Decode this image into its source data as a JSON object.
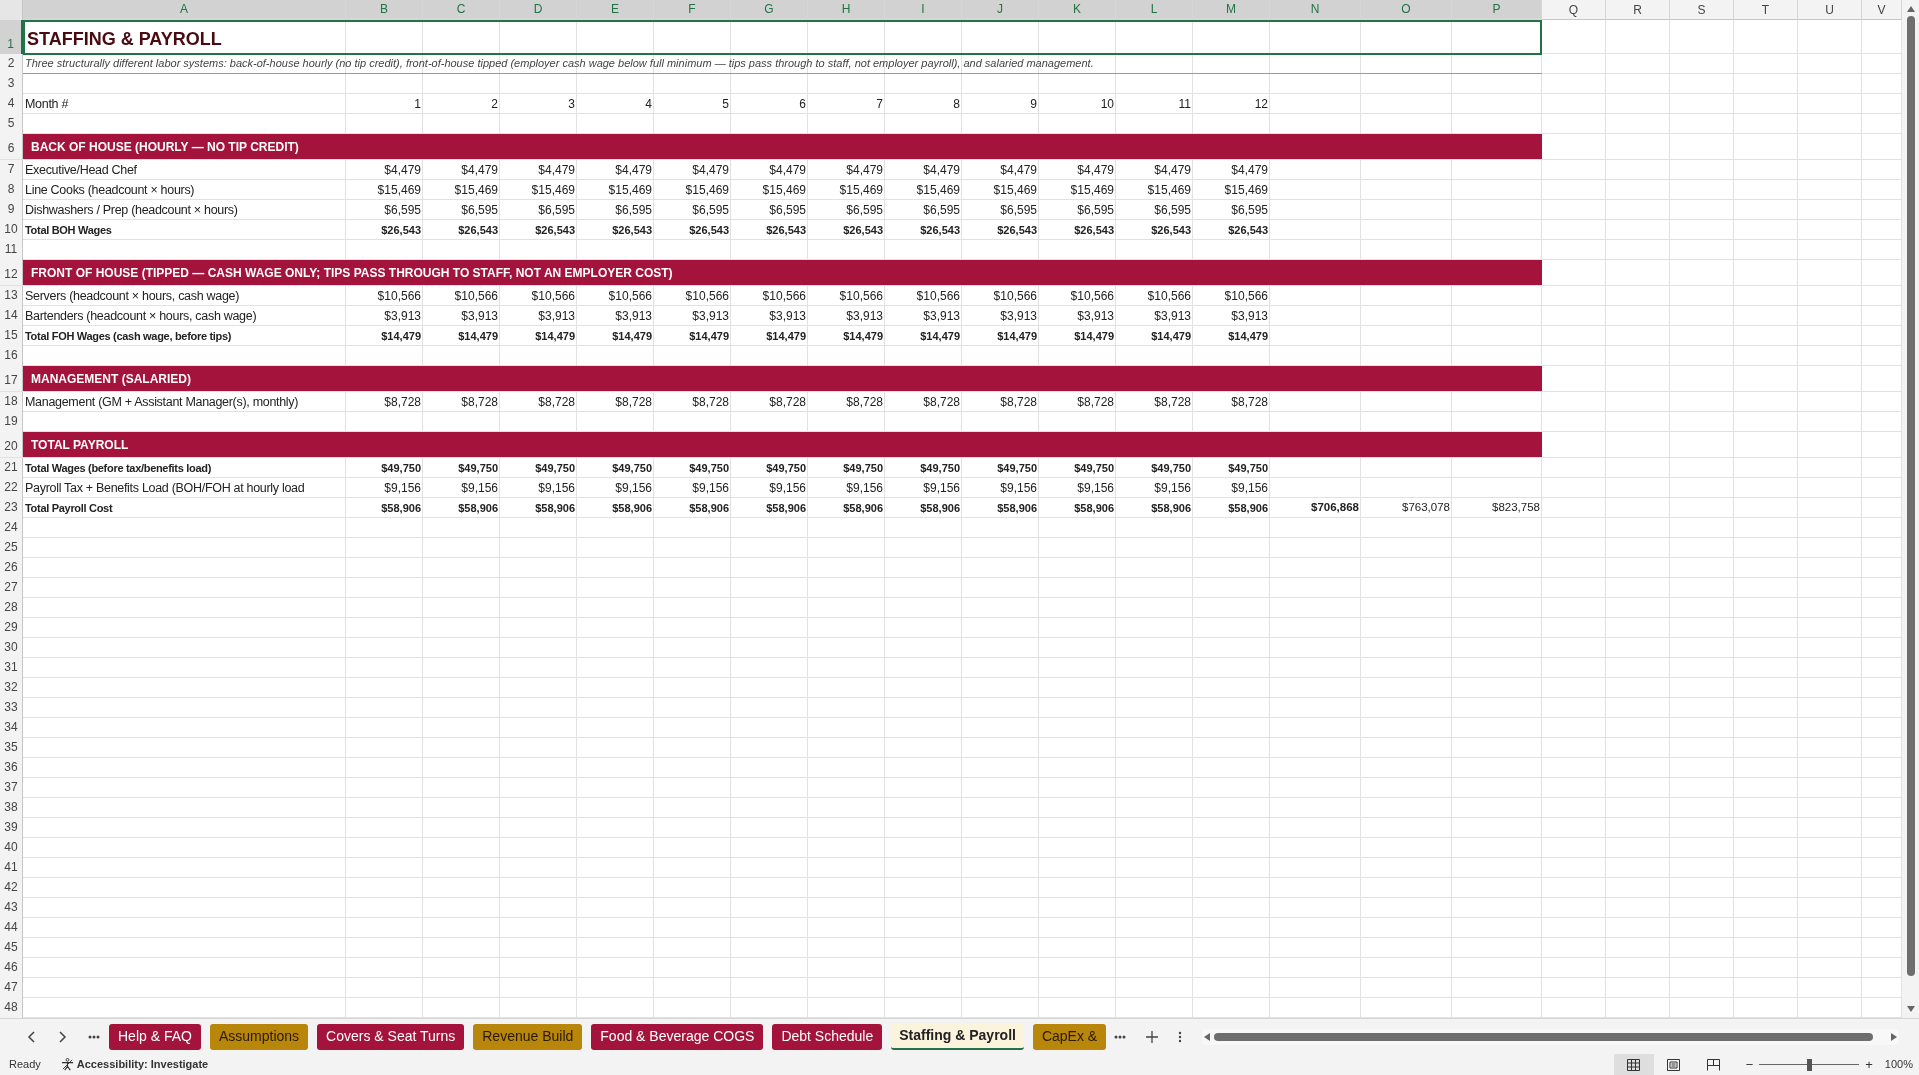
{
  "columns": [
    {
      "label": "A",
      "selected": true
    },
    {
      "label": "B",
      "selected": true
    },
    {
      "label": "C",
      "selected": true
    },
    {
      "label": "D",
      "selected": true
    },
    {
      "label": "E",
      "selected": true
    },
    {
      "label": "F",
      "selected": true
    },
    {
      "label": "G",
      "selected": true
    },
    {
      "label": "H",
      "selected": true
    },
    {
      "label": "I",
      "selected": true
    },
    {
      "label": "J",
      "selected": true
    },
    {
      "label": "K",
      "selected": true
    },
    {
      "label": "L",
      "selected": true
    },
    {
      "label": "M",
      "selected": true
    },
    {
      "label": "N",
      "selected": true
    },
    {
      "label": "O",
      "selected": true
    },
    {
      "label": "P",
      "selected": true
    },
    {
      "label": "Q",
      "selected": false
    },
    {
      "label": "R",
      "selected": false
    },
    {
      "label": "S",
      "selected": false
    },
    {
      "label": "T",
      "selected": false
    },
    {
      "label": "U",
      "selected": false
    },
    {
      "label": "V",
      "selected": false
    }
  ],
  "rows": [
    {
      "number": "1",
      "selected": true,
      "kind": "title",
      "label": "STAFFING & PAYROLL"
    },
    {
      "number": "2",
      "selected": false,
      "kind": "subtitle",
      "label": "Three structurally different labor systems: back-of-house hourly (no tip credit), front-of-house tipped (employer cash wage below full minimum — tips pass through to staff, not employer payroll), and salaried management."
    },
    {
      "number": "3",
      "selected": false,
      "kind": "blank"
    },
    {
      "number": "4",
      "selected": false,
      "kind": "item",
      "label": "Month #",
      "values": [
        "1",
        "2",
        "3",
        "4",
        "5",
        "6",
        "7",
        "8",
        "9",
        "10",
        "11",
        "12"
      ]
    },
    {
      "number": "5",
      "selected": false,
      "kind": "blank"
    },
    {
      "number": "6",
      "selected": false,
      "kind": "section",
      "label": "BACK OF HOUSE (HOURLY — NO TIP CREDIT)"
    },
    {
      "number": "7",
      "selected": false,
      "kind": "item",
      "label": "Executive/Head Chef",
      "values": [
        "$4,479",
        "$4,479",
        "$4,479",
        "$4,479",
        "$4,479",
        "$4,479",
        "$4,479",
        "$4,479",
        "$4,479",
        "$4,479",
        "$4,479",
        "$4,479"
      ]
    },
    {
      "number": "8",
      "selected": false,
      "kind": "item",
      "label": "Line Cooks (headcount × hours)",
      "values": [
        "$15,469",
        "$15,469",
        "$15,469",
        "$15,469",
        "$15,469",
        "$15,469",
        "$15,469",
        "$15,469",
        "$15,469",
        "$15,469",
        "$15,469",
        "$15,469"
      ]
    },
    {
      "number": "9",
      "selected": false,
      "kind": "item",
      "label": "Dishwashers / Prep (headcount × hours)",
      "values": [
        "$6,595",
        "$6,595",
        "$6,595",
        "$6,595",
        "$6,595",
        "$6,595",
        "$6,595",
        "$6,595",
        "$6,595",
        "$6,595",
        "$6,595",
        "$6,595"
      ]
    },
    {
      "number": "10",
      "selected": false,
      "kind": "total",
      "label": "Total BOH Wages",
      "values": [
        "$26,543",
        "$26,543",
        "$26,543",
        "$26,543",
        "$26,543",
        "$26,543",
        "$26,543",
        "$26,543",
        "$26,543",
        "$26,543",
        "$26,543",
        "$26,543"
      ]
    },
    {
      "number": "11",
      "selected": false,
      "kind": "blank"
    },
    {
      "number": "12",
      "selected": false,
      "kind": "section",
      "label": "FRONT OF HOUSE (TIPPED — CASH WAGE ONLY; TIPS PASS THROUGH TO STAFF, NOT AN EMPLOYER COST)"
    },
    {
      "number": "13",
      "selected": false,
      "kind": "item",
      "label": "Servers (headcount × hours, cash wage)",
      "values": [
        "$10,566",
        "$10,566",
        "$10,566",
        "$10,566",
        "$10,566",
        "$10,566",
        "$10,566",
        "$10,566",
        "$10,566",
        "$10,566",
        "$10,566",
        "$10,566"
      ]
    },
    {
      "number": "14",
      "selected": false,
      "kind": "item",
      "label": "Bartenders (headcount × hours, cash wage)",
      "values": [
        "$3,913",
        "$3,913",
        "$3,913",
        "$3,913",
        "$3,913",
        "$3,913",
        "$3,913",
        "$3,913",
        "$3,913",
        "$3,913",
        "$3,913",
        "$3,913"
      ]
    },
    {
      "number": "15",
      "selected": false,
      "kind": "total",
      "label": "Total FOH Wages (cash wage, before tips)",
      "values": [
        "$14,479",
        "$14,479",
        "$14,479",
        "$14,479",
        "$14,479",
        "$14,479",
        "$14,479",
        "$14,479",
        "$14,479",
        "$14,479",
        "$14,479",
        "$14,479"
      ]
    },
    {
      "number": "16",
      "selected": false,
      "kind": "blank"
    },
    {
      "number": "17",
      "selected": false,
      "kind": "section",
      "label": "MANAGEMENT (SALARIED)"
    },
    {
      "number": "18",
      "selected": false,
      "kind": "item",
      "label": "Management (GM + Assistant Manager(s), monthly)",
      "values": [
        "$8,728",
        "$8,728",
        "$8,728",
        "$8,728",
        "$8,728",
        "$8,728",
        "$8,728",
        "$8,728",
        "$8,728",
        "$8,728",
        "$8,728",
        "$8,728"
      ]
    },
    {
      "number": "19",
      "selected": false,
      "kind": "blank"
    },
    {
      "number": "20",
      "selected": false,
      "kind": "section",
      "label": "TOTAL PAYROLL"
    },
    {
      "number": "21",
      "selected": false,
      "kind": "total",
      "label": "Total Wages (before tax/benefits load)",
      "values": [
        "$49,750",
        "$49,750",
        "$49,750",
        "$49,750",
        "$49,750",
        "$49,750",
        "$49,750",
        "$49,750",
        "$49,750",
        "$49,750",
        "$49,750",
        "$49,750"
      ]
    },
    {
      "number": "22",
      "selected": false,
      "kind": "item",
      "label": "Payroll Tax + Benefits Load (BOH/FOH at hourly load",
      "values": [
        "$9,156",
        "$9,156",
        "$9,156",
        "$9,156",
        "$9,156",
        "$9,156",
        "$9,156",
        "$9,156",
        "$9,156",
        "$9,156",
        "$9,156",
        "$9,156"
      ]
    },
    {
      "number": "23",
      "selected": false,
      "kind": "total",
      "label": "Total Payroll Cost",
      "values": [
        "$58,906",
        "$58,906",
        "$58,906",
        "$58,906",
        "$58,906",
        "$58,906",
        "$58,906",
        "$58,906",
        "$58,906",
        "$58,906",
        "$58,906",
        "$58,906"
      ],
      "extra": [
        {
          "text": "$706,868",
          "bold": true
        },
        {
          "text": "$763,078",
          "bold": false
        },
        {
          "text": "$823,758",
          "bold": false
        }
      ]
    },
    {
      "number": "24",
      "selected": false,
      "kind": "blank"
    },
    {
      "number": "25",
      "selected": false,
      "kind": "blank"
    },
    {
      "number": "26",
      "selected": false,
      "kind": "blank"
    },
    {
      "number": "27",
      "selected": false,
      "kind": "blank"
    },
    {
      "number": "28",
      "selected": false,
      "kind": "blank"
    },
    {
      "number": "29",
      "selected": false,
      "kind": "blank"
    },
    {
      "number": "30",
      "selected": false,
      "kind": "blank"
    },
    {
      "number": "31",
      "selected": false,
      "kind": "blank"
    },
    {
      "number": "32",
      "selected": false,
      "kind": "blank"
    },
    {
      "number": "33",
      "selected": false,
      "kind": "blank"
    },
    {
      "number": "34",
      "selected": false,
      "kind": "blank"
    },
    {
      "number": "35",
      "selected": false,
      "kind": "blank"
    },
    {
      "number": "36",
      "selected": false,
      "kind": "blank"
    },
    {
      "number": "37",
      "selected": false,
      "kind": "blank"
    },
    {
      "number": "38",
      "selected": false,
      "kind": "blank"
    },
    {
      "number": "39",
      "selected": false,
      "kind": "blank"
    },
    {
      "number": "40",
      "selected": false,
      "kind": "blank"
    },
    {
      "number": "41",
      "selected": false,
      "kind": "blank"
    },
    {
      "number": "42",
      "selected": false,
      "kind": "blank"
    },
    {
      "number": "43",
      "selected": false,
      "kind": "blank"
    },
    {
      "number": "44",
      "selected": false,
      "kind": "blank"
    },
    {
      "number": "45",
      "selected": false,
      "kind": "blank"
    },
    {
      "number": "46",
      "selected": false,
      "kind": "blank"
    },
    {
      "number": "47",
      "selected": false,
      "kind": "blank"
    },
    {
      "number": "48",
      "selected": false,
      "kind": "blank"
    }
  ],
  "sheet_tabs": [
    {
      "label": "Help & FAQ",
      "color": "#a3133b",
      "selected": false
    },
    {
      "label": "Assumptions",
      "color": "#b8860b",
      "selected": false
    },
    {
      "label": "Covers & Seat Turns",
      "color": "#a3133b",
      "selected": false
    },
    {
      "label": "Revenue Build",
      "color": "#b8860b",
      "selected": false
    },
    {
      "label": "Food & Beverage COGS",
      "color": "#a3133b",
      "selected": false
    },
    {
      "label": "Debt Schedule",
      "color": "#a3133b",
      "selected": false
    },
    {
      "label": "Staffing & Payroll",
      "selected": true
    },
    {
      "label": "CapEx &",
      "color": "#b8860b",
      "selected": false
    }
  ],
  "status_bar": {
    "ready": "Ready",
    "accessibility": "Accessibility: Investigate",
    "zoom_out": "−",
    "zoom_in": "+",
    "zoom_slider": {
      "level": 0.5
    },
    "zoom": "100%"
  }
}
